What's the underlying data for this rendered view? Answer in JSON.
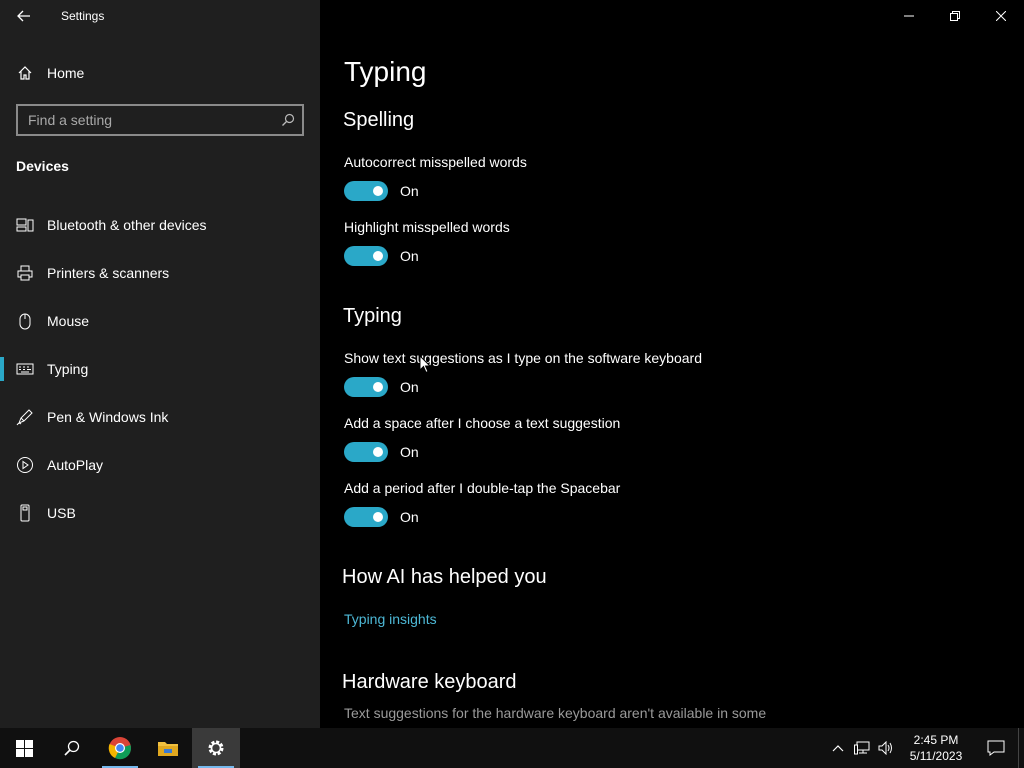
{
  "window": {
    "title": "Settings"
  },
  "sidebar": {
    "home_label": "Home",
    "search_placeholder": "Find a setting",
    "section": "Devices",
    "items": [
      {
        "label": "Bluetooth & other devices",
        "icon": "bluetooth-devices-icon"
      },
      {
        "label": "Printers & scanners",
        "icon": "printer-icon"
      },
      {
        "label": "Mouse",
        "icon": "mouse-icon"
      },
      {
        "label": "Typing",
        "icon": "keyboard-icon",
        "active": true
      },
      {
        "label": "Pen & Windows Ink",
        "icon": "pen-icon"
      },
      {
        "label": "AutoPlay",
        "icon": "autoplay-icon"
      },
      {
        "label": "USB",
        "icon": "usb-icon"
      }
    ]
  },
  "main": {
    "title": "Typing",
    "spelling": {
      "heading": "Spelling",
      "autocorrect_label": "Autocorrect misspelled words",
      "autocorrect_state": "On",
      "highlight_label": "Highlight misspelled words",
      "highlight_state": "On"
    },
    "typing": {
      "heading": "Typing",
      "suggestions_label": "Show text suggestions as I type on the software keyboard",
      "suggestions_state": "On",
      "space_label": "Add a space after I choose a text suggestion",
      "space_state": "On",
      "period_label": "Add a period after I double-tap the Spacebar",
      "period_state": "On"
    },
    "ai": {
      "heading": "How AI has helped you",
      "link": "Typing insights"
    },
    "hardware": {
      "heading": "Hardware keyboard",
      "description": "Text suggestions for the hardware keyboard aren't available in some"
    }
  },
  "taskbar": {
    "time": "2:45 PM",
    "date": "5/11/2023"
  },
  "colors": {
    "accent": "#2aa8c8",
    "link": "#4db8d6",
    "sidebar_bg": "#1f1f1f",
    "main_bg": "#000000"
  }
}
